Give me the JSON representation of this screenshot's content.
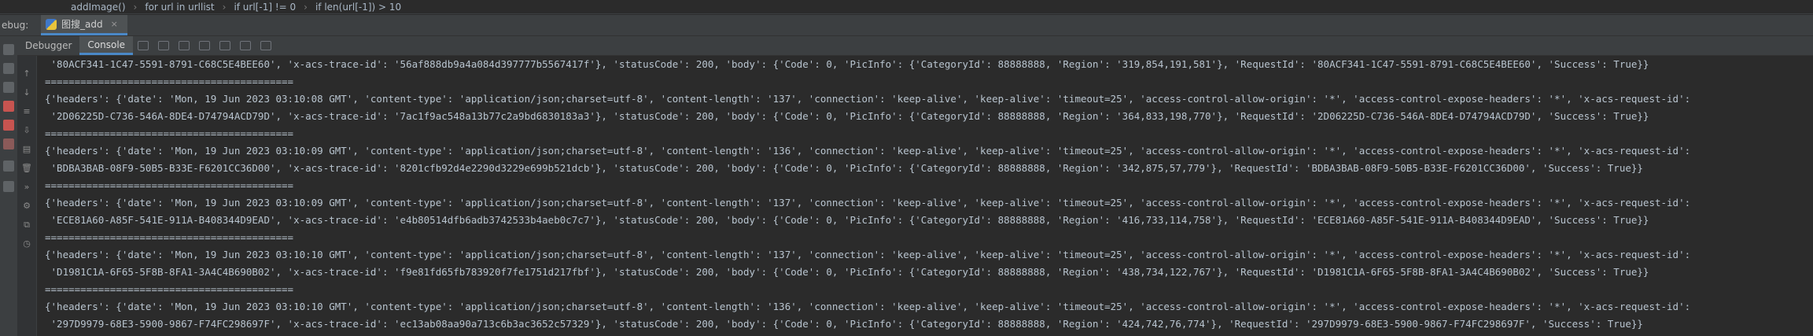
{
  "breadcrumb": [
    "addImage()",
    "for url in urllist",
    "if url[-1] != 0",
    "if len(url[-1]) > 10"
  ],
  "runbar": {
    "label": "ebug:",
    "tab_label": "图搜_add",
    "close_glyph": "×"
  },
  "tabs": {
    "debugger": "Debugger",
    "console": "Console"
  },
  "console_lines": [
    " '80ACF341-1C47-5591-8791-C68C5E4BEE60', 'x-acs-trace-id': '56af888db9a4a084d397777b5567417f'}, 'statusCode': 200, 'body': {'Code': 0, 'PicInfo': {'CategoryId': 88888888, 'Region': '319,854,191,581'}, 'RequestId': '80ACF341-1C47-5591-8791-C68C5E4BEE60', 'Success': True}}",
    "==========================================",
    "{'headers': {'date': 'Mon, 19 Jun 2023 03:10:08 GMT', 'content-type': 'application/json;charset=utf-8', 'content-length': '137', 'connection': 'keep-alive', 'keep-alive': 'timeout=25', 'access-control-allow-origin': '*', 'access-control-expose-headers': '*', 'x-acs-request-id':",
    " '2D06225D-C736-546A-8DE4-D74794ACD79D', 'x-acs-trace-id': '7ac1f9ac548a13b77c2a9bd6830183a3'}, 'statusCode': 200, 'body': {'Code': 0, 'PicInfo': {'CategoryId': 88888888, 'Region': '364,833,198,770'}, 'RequestId': '2D06225D-C736-546A-8DE4-D74794ACD79D', 'Success': True}}",
    "==========================================",
    "{'headers': {'date': 'Mon, 19 Jun 2023 03:10:09 GMT', 'content-type': 'application/json;charset=utf-8', 'content-length': '136', 'connection': 'keep-alive', 'keep-alive': 'timeout=25', 'access-control-allow-origin': '*', 'access-control-expose-headers': '*', 'x-acs-request-id':",
    " 'BDBA3BAB-08F9-50B5-B33E-F6201CC36D00', 'x-acs-trace-id': '8201cfb92d4e2290d3229e699b521dcb'}, 'statusCode': 200, 'body': {'Code': 0, 'PicInfo': {'CategoryId': 88888888, 'Region': '342,875,57,779'}, 'RequestId': 'BDBA3BAB-08F9-50B5-B33E-F6201CC36D00', 'Success': True}}",
    "==========================================",
    "{'headers': {'date': 'Mon, 19 Jun 2023 03:10:09 GMT', 'content-type': 'application/json;charset=utf-8', 'content-length': '137', 'connection': 'keep-alive', 'keep-alive': 'timeout=25', 'access-control-allow-origin': '*', 'access-control-expose-headers': '*', 'x-acs-request-id':",
    " 'ECE81A60-A85F-541E-911A-B408344D9EAD', 'x-acs-trace-id': 'e4b80514dfb6adb3742533b4aeb0c7c7'}, 'statusCode': 200, 'body': {'Code': 0, 'PicInfo': {'CategoryId': 88888888, 'Region': '416,733,114,758'}, 'RequestId': 'ECE81A60-A85F-541E-911A-B408344D9EAD', 'Success': True}}",
    "==========================================",
    "{'headers': {'date': 'Mon, 19 Jun 2023 03:10:10 GMT', 'content-type': 'application/json;charset=utf-8', 'content-length': '137', 'connection': 'keep-alive', 'keep-alive': 'timeout=25', 'access-control-allow-origin': '*', 'access-control-expose-headers': '*', 'x-acs-request-id':",
    " 'D1981C1A-6F65-5F8B-8FA1-3A4C4B690B02', 'x-acs-trace-id': 'f9e81fd65fb783920f7fe1751d217fbf'}, 'statusCode': 200, 'body': {'Code': 0, 'PicInfo': {'CategoryId': 88888888, 'Region': '438,734,122,767'}, 'RequestId': 'D1981C1A-6F65-5F8B-8FA1-3A4C4B690B02', 'Success': True}}",
    "==========================================",
    "{'headers': {'date': 'Mon, 19 Jun 2023 03:10:10 GMT', 'content-type': 'application/json;charset=utf-8', 'content-length': '136', 'connection': 'keep-alive', 'keep-alive': 'timeout=25', 'access-control-allow-origin': '*', 'access-control-expose-headers': '*', 'x-acs-request-id':",
    " '297D9979-68E3-5900-9867-F74FC298697F', 'x-acs-trace-id': 'ec13ab08aa90a713c6b3ac3652c57329'}, 'statusCode': 200, 'body': {'Code': 0, 'PicInfo': {'CategoryId': 88888888, 'Region': '424,742,76,774'}, 'RequestId': '297D9979-68E3-5900-9867-F74FC298697F', 'Success': True}}"
  ],
  "colors": {
    "background": "#2b2b2b",
    "toolbar": "#3c3f41",
    "accent": "#4a88c7",
    "text": "#b8c4cf",
    "stop_red": "#c75450"
  }
}
